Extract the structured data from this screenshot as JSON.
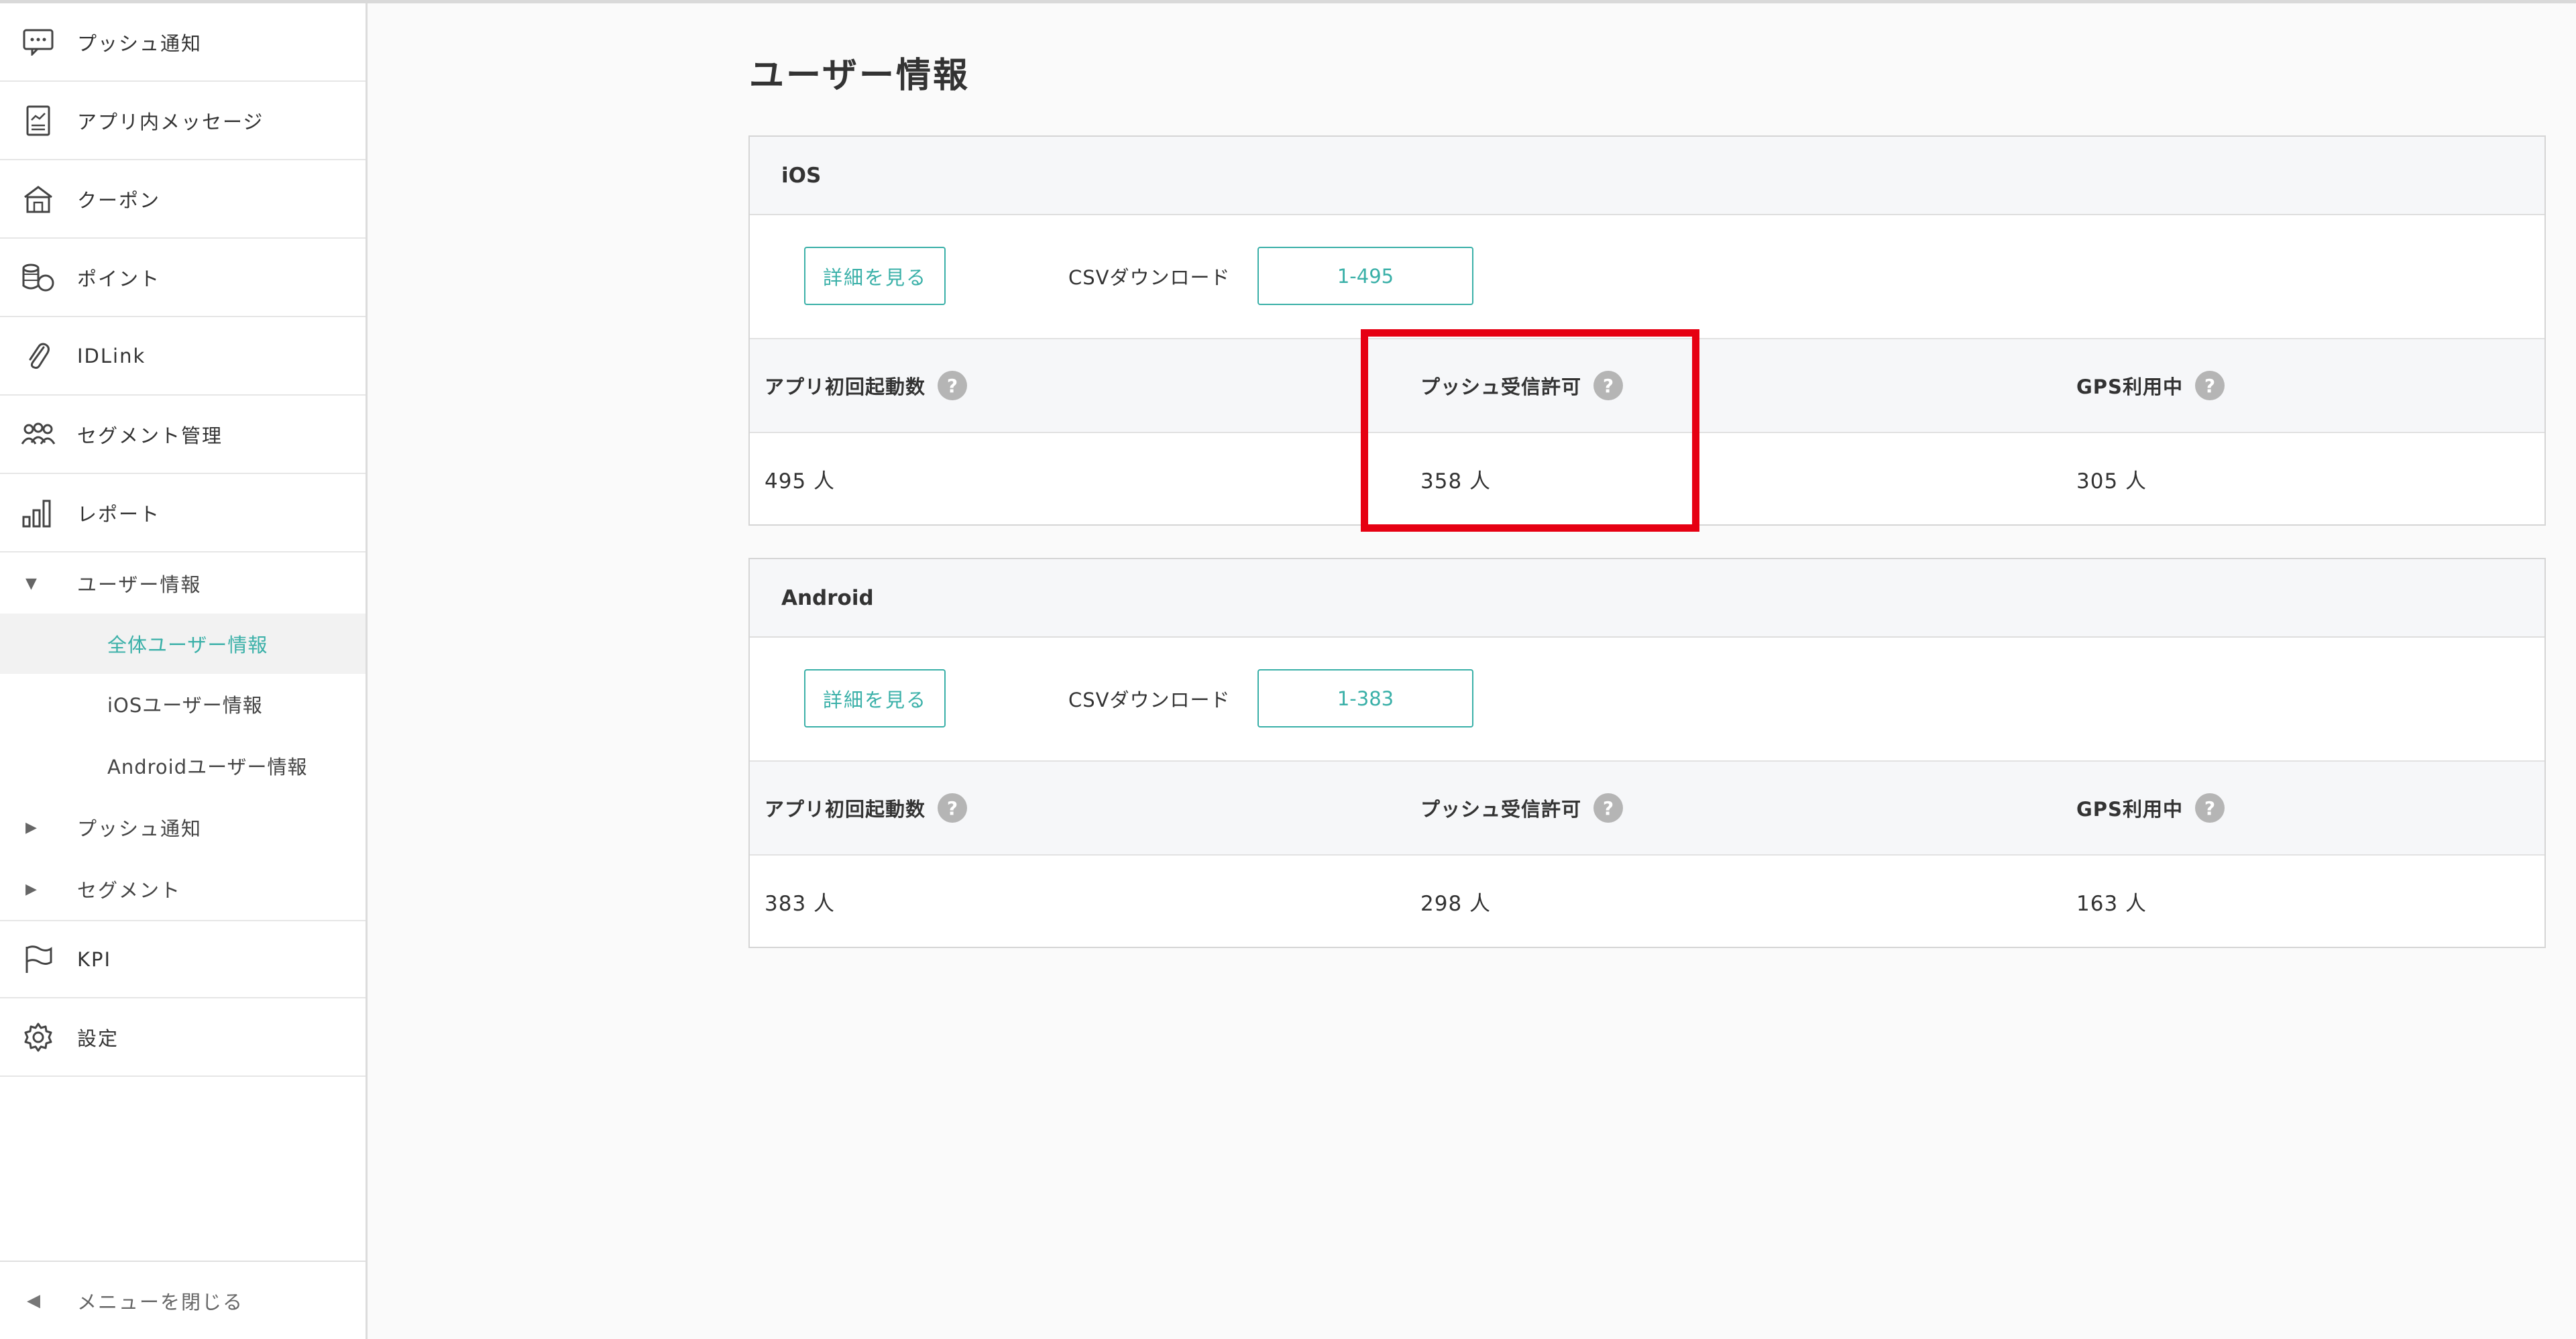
{
  "sidebar": {
    "items": [
      {
        "label": "プッシュ通知",
        "icon": "message-bubble-icon"
      },
      {
        "label": "アプリ内メッセージ",
        "icon": "document-chart-icon"
      },
      {
        "label": "クーポン",
        "icon": "store-icon"
      },
      {
        "label": "ポイント",
        "icon": "coins-icon"
      },
      {
        "label": "IDLink",
        "icon": "paperclip-icon"
      },
      {
        "label": "セグメント管理",
        "icon": "users-icon"
      },
      {
        "label": "レポート",
        "icon": "bar-chart-icon"
      }
    ],
    "tree": {
      "user_info": "ユーザー情報",
      "sub": [
        "全体ユーザー情報",
        "iOSユーザー情報",
        "Androidユーザー情報"
      ],
      "push": "プッシュ通知",
      "segment": "セグメント"
    },
    "bottom_items": [
      {
        "label": "KPI",
        "icon": "flag-icon"
      },
      {
        "label": "設定",
        "icon": "gear-icon"
      }
    ],
    "footer": "メニューを閉じる"
  },
  "main": {
    "title": "ユーザー情報",
    "ios": {
      "title": "iOS",
      "detail_button": "詳細を見る",
      "csv_label": "CSVダウンロード",
      "csv_button": "1-495",
      "stats": {
        "first_launch_label": "アプリ初回起動数",
        "push_label": "プッシュ受信許可",
        "gps_label": "GPS利用中",
        "first_launch_value": "495 人",
        "push_value": "358 人",
        "gps_value": "305 人"
      }
    },
    "android": {
      "title": "Android",
      "detail_button": "詳細を見る",
      "csv_label": "CSVダウンロード",
      "csv_button": "1-383",
      "stats": {
        "first_launch_label": "アプリ初回起動数",
        "push_label": "プッシュ受信許可",
        "gps_label": "GPS利用中",
        "first_launch_value": "383 人",
        "push_value": "298 人",
        "gps_value": "163 人"
      }
    },
    "help_glyph": "?"
  },
  "colors": {
    "accent": "#3ab0a8",
    "highlight": "#e60012"
  }
}
